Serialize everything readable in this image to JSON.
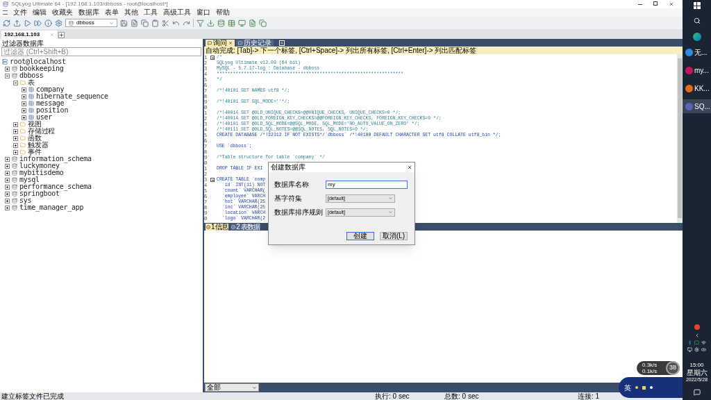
{
  "window": {
    "title": "SQLyog Ultimate 64 - [192.168.1.103/dbboss - root@localhost*]"
  },
  "menu": [
    "文件",
    "编辑",
    "收藏夹",
    "数据库",
    "表单",
    "其他",
    "工具",
    "高级工具",
    "窗口",
    "帮助"
  ],
  "toolbar": {
    "database": "dbboss"
  },
  "connection_tabs": [
    {
      "label": "192.168.1.103",
      "selected": true
    }
  ],
  "explorer": {
    "title": "过滤器数据库",
    "filter_placeholder": "过滤器 (Ctrl+Shift+B)",
    "tree": [
      {
        "label": "root@localhost",
        "kind": "server",
        "expanded": true,
        "children": [
          {
            "label": "bookkeeping",
            "kind": "database",
            "expanded": false
          },
          {
            "label": "dbboss",
            "kind": "database",
            "expanded": true,
            "children": [
              {
                "label": "表",
                "kind": "folder",
                "expanded": true,
                "children": [
                  {
                    "label": "company",
                    "kind": "table",
                    "expanded": false
                  },
                  {
                    "label": "hibernate_sequence",
                    "kind": "table",
                    "expanded": false
                  },
                  {
                    "label": "message",
                    "kind": "table",
                    "expanded": false
                  },
                  {
                    "label": "position",
                    "kind": "table",
                    "expanded": false
                  },
                  {
                    "label": "user",
                    "kind": "table",
                    "expanded": false
                  }
                ]
              },
              {
                "label": "视图",
                "kind": "folder",
                "expanded": false
              },
              {
                "label": "存储过程",
                "kind": "folder",
                "expanded": false
              },
              {
                "label": "函数",
                "kind": "folder",
                "expanded": false
              },
              {
                "label": "触发器",
                "kind": "folder",
                "expanded": false
              },
              {
                "label": "事件",
                "kind": "folder",
                "expanded": false
              }
            ]
          },
          {
            "label": "information_schema",
            "kind": "database",
            "expanded": false
          },
          {
            "label": "luckymoney",
            "kind": "database",
            "expanded": false
          },
          {
            "label": "mybitisdemo",
            "kind": "database",
            "expanded": false
          },
          {
            "label": "mysql",
            "kind": "database",
            "expanded": false
          },
          {
            "label": "performance_schema",
            "kind": "database",
            "expanded": false
          },
          {
            "label": "springboot",
            "kind": "database",
            "expanded": false
          },
          {
            "label": "sys",
            "kind": "database",
            "expanded": false
          },
          {
            "label": "time_manager_app",
            "kind": "database",
            "expanded": false
          }
        ]
      }
    ]
  },
  "editor_tabs": [
    {
      "label": "询问",
      "selected": true,
      "closable": true
    },
    {
      "label": "历史记录",
      "selected": false,
      "closable": false
    }
  ],
  "hint": "自动完成: [Tab]-> 下一个标签, [Ctrl+Space]-> 列出所有标签, [Ctrl+Enter]-> 列出匹配标签",
  "code": [
    {
      "n": "1",
      "kind": "comment",
      "fold": true,
      "text": "/*"
    },
    {
      "n": "2",
      "kind": "comment",
      "fold": false,
      "text": "SQLyog Ultimate v12.09 (64 bit)"
    },
    {
      "n": "3",
      "kind": "comment",
      "fold": false,
      "text": "MySQL - 5.7.17-log : Database - dbboss"
    },
    {
      "n": "4",
      "kind": "comment",
      "fold": false,
      "text": "*********************************************************************"
    },
    {
      "n": "5",
      "kind": "comment",
      "fold": false,
      "text": "*/"
    },
    {
      "n": "6",
      "kind": "blank",
      "fold": false
    },
    {
      "n": "7",
      "kind": "comment",
      "fold": false,
      "text": "/*!40101 SET NAMES utf8 */;"
    },
    {
      "n": "8",
      "kind": "blank",
      "fold": false
    },
    {
      "n": "9",
      "kind": "comment",
      "fold": false,
      "text": "/*!40101 SET SQL_MODE=''*/;"
    },
    {
      "n": "0",
      "kind": "blank",
      "fold": false
    },
    {
      "n": "1",
      "kind": "comment",
      "fold": false,
      "text": "/*!40014 SET @OLD_UNIQUE_CHECKS=@@UNIQUE_CHECKS, UNIQUE_CHECKS=0 */;"
    },
    {
      "n": "2",
      "kind": "comment",
      "fold": false,
      "text": "/*!40014 SET @OLD_FOREIGN_KEY_CHECKS=@@FOREIGN_KEY_CHECKS, FOREIGN_KEY_CHECKS=0 */;"
    },
    {
      "n": "3",
      "kind": "comment",
      "fold": false,
      "text": "/*!40101 SET @OLD_SQL_MODE=@@SQL_MODE, SQL_MODE='NO_AUTO_VALUE_ON_ZERO' */;"
    },
    {
      "n": "4",
      "kind": "comment",
      "fold": false,
      "text": "/*!40111 SET @OLD_SQL_NOTES=@@SQL_NOTES, SQL_NOTES=0 */;"
    },
    {
      "n": "5",
      "kind": "sql",
      "fold": false,
      "text": "CREATE DATABASE /*!32312 IF NOT EXISTS*/`dbboss` /*!40100 DEFAULT CHARACTER SET utf8 COLLATE utf8_bin */;"
    },
    {
      "n": "6",
      "kind": "blank",
      "fold": false
    },
    {
      "n": "7",
      "kind": "sql",
      "fold": false,
      "text": "USE `dbboss`;"
    },
    {
      "n": "8",
      "kind": "blank",
      "fold": false
    },
    {
      "n": "9",
      "kind": "comment",
      "fold": false,
      "text": "/*Table structure for table `company` */"
    },
    {
      "n": "0",
      "kind": "blank",
      "fold": false
    },
    {
      "n": "1",
      "kind": "sql",
      "fold": false,
      "text": "DROP TABLE IF EXI"
    },
    {
      "n": "2",
      "kind": "blank",
      "fold": false
    },
    {
      "n": "3",
      "kind": "sql",
      "fold": true,
      "text": "CREATE TABLE `comp"
    },
    {
      "n": "4",
      "kind": "sql",
      "fold": false,
      "text": "  `id` INT(11) NOT"
    },
    {
      "n": "5",
      "kind": "sql",
      "fold": false,
      "text": "  `count` VARCHAR("
    },
    {
      "n": "6",
      "kind": "sql",
      "fold": false,
      "text": "  `employee` VARCH"
    },
    {
      "n": "7",
      "kind": "sql",
      "fold": false,
      "text": "  `hot` VARCHAR(25"
    },
    {
      "n": "8",
      "kind": "sql",
      "fold": false,
      "text": "  `inc` VARCHAR(25"
    },
    {
      "n": "9",
      "kind": "sql",
      "fold": false,
      "text": "  `location` VARCH"
    },
    {
      "n": "0",
      "kind": "sql",
      "fold": false,
      "text": "  `logo` VARCHAR(2"
    }
  ],
  "result_tabs": [
    {
      "label": "1 信息",
      "selected": true
    },
    {
      "label": "2 表数据",
      "selected": false
    }
  ],
  "result_filter": "全部",
  "dialog": {
    "title": "创建数据库",
    "fields": [
      {
        "kind": "input",
        "label": "数据库名称",
        "value": "my"
      },
      {
        "kind": "select",
        "label": "基字符集",
        "value": "[default]"
      },
      {
        "kind": "select",
        "label": "数据库排序规则",
        "value": "[default]"
      }
    ],
    "buttons": [
      {
        "label": "创建",
        "primary": true
      },
      {
        "label": "取消(L)",
        "primary": false
      }
    ]
  },
  "status_bar": {
    "message": "建立标签文件已完成",
    "exec": "执行: 0 sec",
    "total": "总数: 0 sec",
    "connections": "连接: 1"
  },
  "taskbar": {
    "apps": [
      {
        "label": "无...",
        "selected": false
      },
      {
        "label": "my...",
        "selected": false
      },
      {
        "label": "KK...",
        "selected": false
      },
      {
        "label": "SQ...",
        "selected": true
      }
    ],
    "time": "15:00",
    "weekday": "星期六",
    "date": "2022/5/28"
  },
  "net_widget": {
    "up": "0.3k/s",
    "down": "0.1k/s",
    "percent": "38"
  },
  "ime": {
    "label": "英"
  }
}
